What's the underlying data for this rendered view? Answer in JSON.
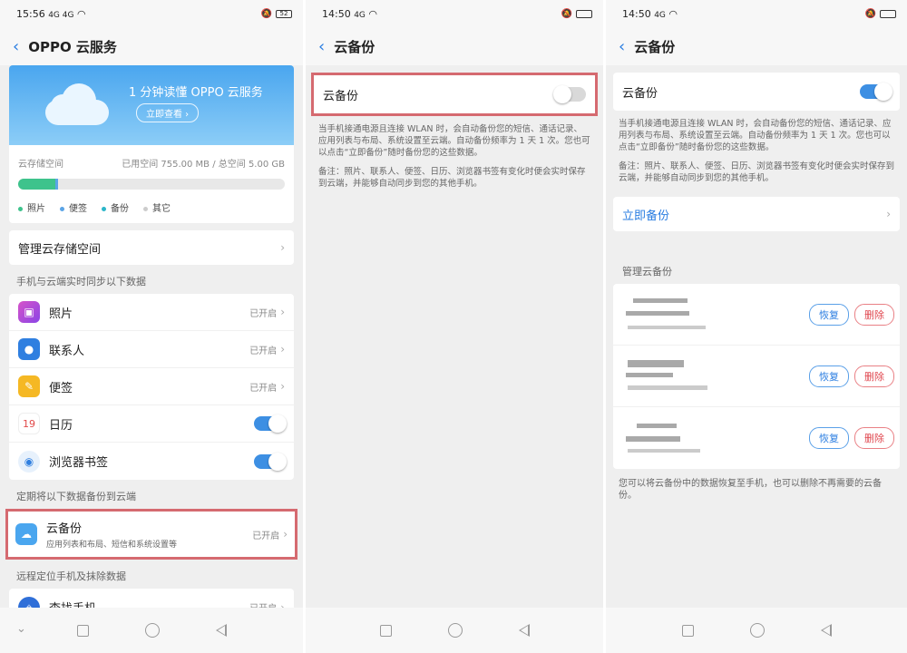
{
  "panel1": {
    "status": {
      "time": "15:56",
      "signal": "4G 4G",
      "battery": "52"
    },
    "title": "OPPO 云服务",
    "banner": {
      "title": "1 分钟读懂 OPPO 云服务",
      "button": "立即查看 ›"
    },
    "storage": {
      "label": "云存储空间",
      "usage": "已用空间 755.00 MB / 总空间 5.00 GB",
      "photo_fraction": 0.14,
      "note_fraction": 0.01,
      "legend": [
        "照片",
        "便签",
        "备份",
        "其它"
      ],
      "legend_colors": [
        "#3ec38c",
        "#5aa4e6",
        "#2bb6c9",
        "#cccccc"
      ]
    },
    "manage": "管理云存储空间",
    "sync_section": "手机与云端实时同步以下数据",
    "sync_items": [
      {
        "label": "照片",
        "status": "已开启",
        "icon": "photos-icon"
      },
      {
        "label": "联系人",
        "status": "已开启",
        "icon": "contacts-icon"
      },
      {
        "label": "便签",
        "status": "已开启",
        "icon": "notes-icon"
      },
      {
        "label": "日历",
        "calendar_day": "19",
        "toggle": true,
        "icon": "calendar-icon"
      },
      {
        "label": "浏览器书签",
        "toggle": true,
        "icon": "browser-icon"
      }
    ],
    "backup_section": "定期将以下数据备份到云端",
    "backup_item": {
      "label": "云备份",
      "sub": "应用列表和布局、短信和系统设置等",
      "status": "已开启"
    },
    "find_section": "远程定位手机及抹除数据",
    "find_item": {
      "label": "查找手机",
      "status": "已开启"
    }
  },
  "panel2": {
    "status": {
      "time": "14:50",
      "signal": "4G"
    },
    "title": "云备份",
    "toggle_label": "云备份",
    "toggle_on": false,
    "desc1": "当手机接通电源且连接 WLAN 时，会自动备份您的短信、通话记录、应用列表与布局、系统设置至云端。自动备份频率为 1 天 1 次。您也可以点击“立即备份”随时备份您的这些数据。",
    "desc2": "备注：照片、联系人、便签、日历、浏览器书签有变化时便会实时保存到云端，并能够自动同步到您的其他手机。"
  },
  "panel3": {
    "status": {
      "time": "14:50",
      "signal": "4G"
    },
    "title": "云备份",
    "toggle_label": "云备份",
    "toggle_on": true,
    "desc1": "当手机接通电源且连接 WLAN 时，会自动备份您的短信、通话记录、应用列表与布局、系统设置至云端。自动备份频率为 1 天 1 次。您也可以点击“立即备份”随时备份您的这些数据。",
    "desc2": "备注：照片、联系人、便签、日历、浏览器书签有变化时便会实时保存到云端，并能够自动同步到您的其他手机。",
    "now_backup": "立即备份",
    "manage_label": "管理云备份",
    "records": [
      {
        "restore": "恢复",
        "delete": "删除"
      },
      {
        "restore": "恢复",
        "delete": "删除"
      },
      {
        "restore": "恢复",
        "delete": "删除"
      }
    ],
    "footer": "您可以将云备份中的数据恢复至手机，也可以删除不再需要的云备份。"
  }
}
